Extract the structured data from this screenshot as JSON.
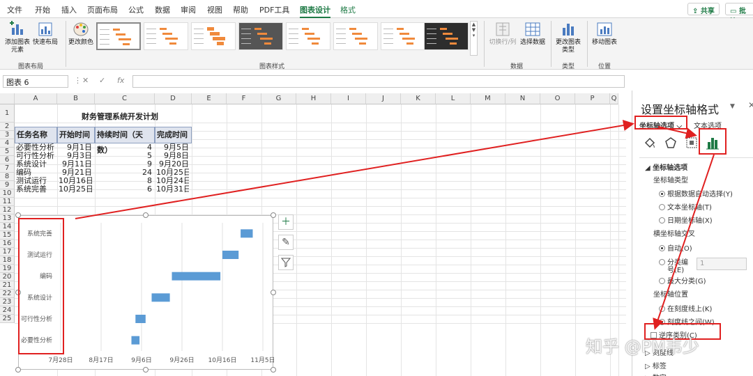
{
  "menubar": {
    "tabs": [
      "文件",
      "开始",
      "插入",
      "页面布局",
      "公式",
      "数据",
      "审阅",
      "视图",
      "帮助",
      "PDF工具",
      "图表设计",
      "格式"
    ],
    "active_tab": "图表设计",
    "share_label": "共享",
    "comment_label": "批注"
  },
  "ribbon": {
    "add_element_label": "添加图表元素",
    "quick_layout_label": "快速布局",
    "layout_group": "图表布局",
    "change_color_label": "更改颜色",
    "styles_group": "图表样式",
    "switch_rowcol_label": "切换行/列",
    "select_data_label": "选择数据",
    "data_group": "数据",
    "change_type_label": "更改图表类型",
    "type_group": "类型",
    "move_chart_label": "移动图表",
    "location_group": "位置"
  },
  "formula_bar": {
    "name_box": "图表 6",
    "fx": "fx"
  },
  "columns": [
    "A",
    "B",
    "C",
    "D",
    "E",
    "F",
    "G",
    "H",
    "I",
    "J",
    "K",
    "L",
    "M",
    "N",
    "O",
    "P",
    "Q"
  ],
  "rows": [
    "1",
    "2",
    "3",
    "4",
    "5",
    "6",
    "7",
    "8",
    "9",
    "10",
    "11",
    "12",
    "13",
    "14",
    "15",
    "16",
    "17",
    "18",
    "19",
    "20",
    "21",
    "22",
    "23",
    "24",
    "25"
  ],
  "sheet": {
    "title": "财务管理系统开发计划",
    "headers": [
      "任务名称",
      "开始时间",
      "持续时间（天数）",
      "完成时间"
    ],
    "data": [
      [
        "必要性分析",
        "9月1日",
        "4",
        "9月5日"
      ],
      [
        "可行性分析",
        "9月3日",
        "5",
        "9月8日"
      ],
      [
        "系统设计",
        "9月11日",
        "9",
        "9月20日"
      ],
      [
        "编码",
        "9月21日",
        "24",
        "10月25日"
      ],
      [
        "测试运行",
        "10月16日",
        "8",
        "10月24日"
      ],
      [
        "系统完善",
        "10月25日",
        "6",
        "10月31日"
      ]
    ]
  },
  "chart_data": {
    "type": "bar",
    "categories": [
      "必要性分析",
      "可行性分析",
      "系统设计",
      "编码",
      "测试运行",
      "系统完善"
    ],
    "series": [
      {
        "values": [
          "9月1日",
          "9月3日",
          "9月11日",
          "9月21日",
          "10月16日",
          "10月25日"
        ]
      },
      {
        "values": [
          4,
          5,
          9,
          24,
          8,
          6
        ]
      }
    ],
    "x_tick_labels": [
      "7月28日",
      "8月17日",
      "9月6日",
      "9月26日",
      "10月16日",
      "11月5日"
    ],
    "y_axis_order": "reversed",
    "grid": true,
    "bar_color": "#5b9bd5"
  },
  "pane": {
    "title": "设置坐标轴格式",
    "tab_axis_options": "坐标轴选项",
    "tab_text_options": "文本选项",
    "section_axis_options": "坐标轴选项",
    "axis_type_label": "坐标轴类型",
    "axis_type_auto": "根据数据自动选择(Y)",
    "axis_type_text": "文本坐标轴(T)",
    "axis_type_date": "日期坐标轴(X)",
    "cross_label": "横坐标轴交叉",
    "cross_auto": "自动(O)",
    "cross_category_line1": "分类编",
    "cross_category_line2": "号(E)",
    "cross_category_value": "1",
    "cross_max": "最大分类(G)",
    "position_label": "坐标轴位置",
    "position_on_tick": "在刻度线上(K)",
    "position_between": "刻度线之间(W)",
    "reverse_label": "逆序类别(C)",
    "tick_marks": "刻度线",
    "labels_section": "标签",
    "number_section": "数字"
  },
  "watermark": "知乎 @PM韦少"
}
